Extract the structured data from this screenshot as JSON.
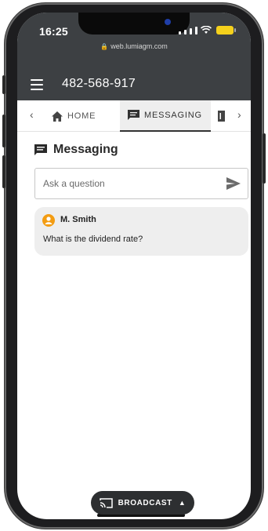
{
  "status_bar": {
    "time": "16:25",
    "url": "web.lumiagm.com"
  },
  "header": {
    "meeting_id": "482-568-917"
  },
  "tabs": [
    {
      "label": "HOME",
      "icon": "home-icon"
    },
    {
      "label": "MESSAGING",
      "icon": "message-icon",
      "active": true
    }
  ],
  "messaging": {
    "title": "Messaging",
    "ask_placeholder": "Ask a question",
    "messages": [
      {
        "author": "M. Smith",
        "text": "What is the dividend rate?"
      }
    ]
  },
  "broadcast": {
    "label": "BROADCAST"
  },
  "colors": {
    "header_bg": "#3d4043",
    "active_tab_bg": "#eeeeee",
    "message_bg": "#eeeeee",
    "avatar_orange": "#f39c12"
  }
}
